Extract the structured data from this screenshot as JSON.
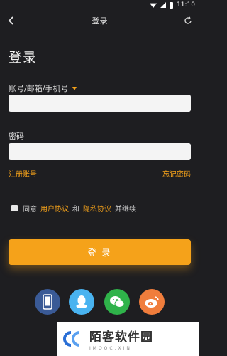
{
  "status_bar": {
    "time": "11:10"
  },
  "nav": {
    "title": "登录",
    "back_icon": "chevron-left-icon",
    "refresh_icon": "refresh-icon"
  },
  "page_title": "登录",
  "account": {
    "label": "账号/邮箱/手机号",
    "value": "",
    "placeholder": ""
  },
  "password": {
    "label": "密码",
    "value": "",
    "placeholder": ""
  },
  "links": {
    "register": "注册账号",
    "forgot": "忘记密码"
  },
  "agreement": {
    "prefix": "同意",
    "user_agreement": "用户协议",
    "and": "和",
    "privacy_policy": "隐私协议",
    "suffix": "并继续",
    "checked": false
  },
  "login_button": "登 录",
  "social_logins": [
    {
      "icon": "phone-icon",
      "color": "#3a5a96"
    },
    {
      "icon": "qq-icon",
      "color": "#49b3f0"
    },
    {
      "icon": "wechat-icon",
      "color": "#2fb34a"
    },
    {
      "icon": "weibo-icon",
      "color": "#f07d3c"
    }
  ],
  "watermark": {
    "name": "陌客软件园",
    "domain": "IMOOC.XIN"
  },
  "colors": {
    "background": "#1e1e21",
    "accent": "#f5a21a",
    "input_bg": "#f4f4f4"
  }
}
